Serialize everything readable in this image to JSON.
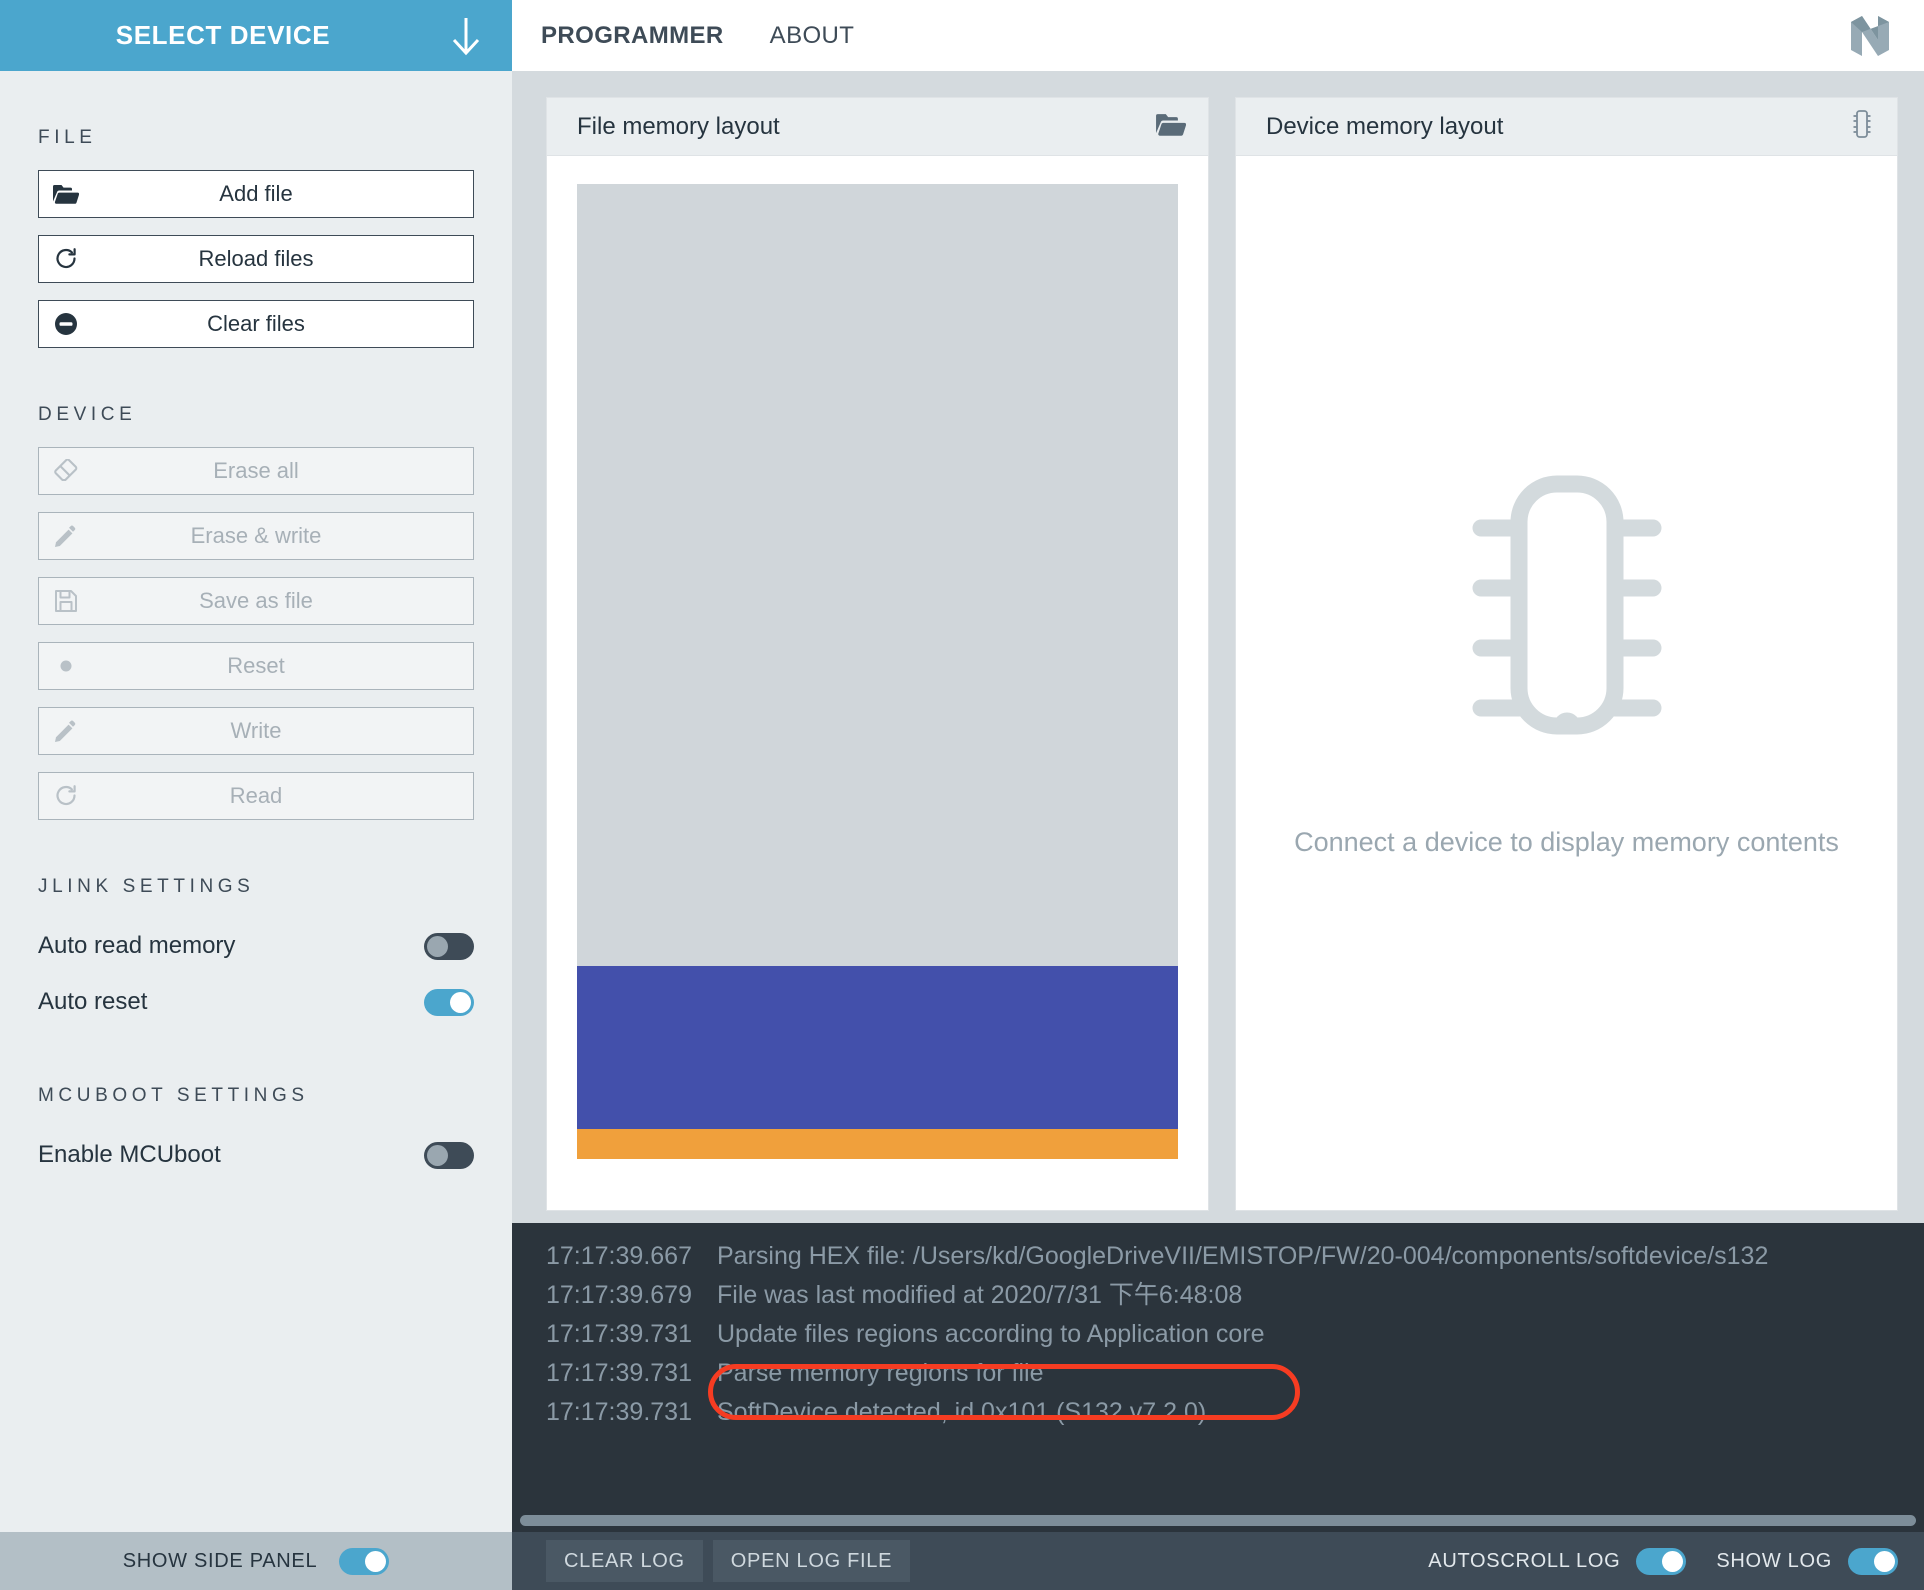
{
  "header": {
    "select_device_label": "SELECT DEVICE",
    "select_device_icon": "arrow-down-icon",
    "tabs": [
      {
        "label": "PROGRAMMER",
        "active": true
      },
      {
        "label": "ABOUT",
        "active": false
      }
    ],
    "logo_icon": "nordic-n-logo-icon"
  },
  "sidebar": {
    "sections": [
      {
        "title": "FILE",
        "buttons": [
          {
            "label": "Add file",
            "icon": "folder-open-icon",
            "disabled": false
          },
          {
            "label": "Reload files",
            "icon": "refresh-icon",
            "disabled": false
          },
          {
            "label": "Clear files",
            "icon": "minus-circle-icon",
            "disabled": false
          }
        ]
      },
      {
        "title": "DEVICE",
        "buttons": [
          {
            "label": "Erase all",
            "icon": "eraser-icon",
            "disabled": true
          },
          {
            "label": "Erase & write",
            "icon": "pencil-icon",
            "disabled": true
          },
          {
            "label": "Save as file",
            "icon": "floppy-disk-icon",
            "disabled": true
          },
          {
            "label": "Reset",
            "icon": "dot-circle-icon",
            "disabled": true
          },
          {
            "label": "Write",
            "icon": "pencil-icon",
            "disabled": true
          },
          {
            "label": "Read",
            "icon": "refresh-icon",
            "disabled": true
          }
        ]
      }
    ],
    "jlink_settings": {
      "title": "JLINK SETTINGS",
      "toggles": [
        {
          "label": "Auto read memory",
          "on": false
        },
        {
          "label": "Auto reset",
          "on": true
        }
      ]
    },
    "mcuboot_settings": {
      "title": "MCUBOOT SETTINGS",
      "toggles": [
        {
          "label": "Enable MCUboot",
          "on": false
        }
      ]
    }
  },
  "panels": {
    "file_memory": {
      "title": "File memory layout",
      "icon": "folder-open-icon",
      "regions": [
        {
          "name": "empty-region",
          "color": "#d0d6da",
          "height_pct": 78.5
        },
        {
          "name": "softdevice-region",
          "color": "#4350ab",
          "height_pct": 16.4
        },
        {
          "name": "bootloader-region",
          "color": "#f0a03c",
          "height_pct": 3.0
        },
        {
          "name": "tail-region",
          "color": "#ffffff",
          "height_pct": 2.1
        }
      ]
    },
    "device_memory": {
      "title": "Device memory layout",
      "icon": "chip-icon",
      "placeholder_icon": "chip-icon",
      "placeholder_text": "Connect a device to display memory contents"
    }
  },
  "log": {
    "lines": [
      {
        "time": "17:17:39.667",
        "message": "Parsing HEX file: /Users/kd/GoogleDriveVII/EMISTOP/FW/20-004/components/softdevice/s132"
      },
      {
        "time": "17:17:39.679",
        "message": "File was last modified at 2020/7/31 下午6:48:08"
      },
      {
        "time": "17:17:39.731",
        "message": "Update files regions according to Application core"
      },
      {
        "time": "17:17:39.731",
        "message": "Parse memory regions for file"
      },
      {
        "time": "17:17:39.731",
        "message": "SoftDevice detected, id 0x101 (S132 v7.2.0)"
      }
    ],
    "annotation_color": "#f63c22",
    "annotated_line_index": 4
  },
  "bottom_bar": {
    "show_side_panel": {
      "label": "SHOW SIDE PANEL",
      "on": true
    },
    "clear_log_label": "CLEAR LOG",
    "open_log_file_label": "OPEN LOG FILE",
    "autoscroll_log": {
      "label": "AUTOSCROLL LOG",
      "on": true
    },
    "show_log": {
      "label": "SHOW LOG",
      "on": true
    }
  },
  "colors": {
    "accent": "#4ba6cd",
    "sidebar_bg": "#eaeef0",
    "dark": "#3e4b57",
    "log_bg": "#2b343c",
    "softdevice": "#4350ab",
    "bootloader": "#f0a03c",
    "annotation": "#f63c22"
  }
}
